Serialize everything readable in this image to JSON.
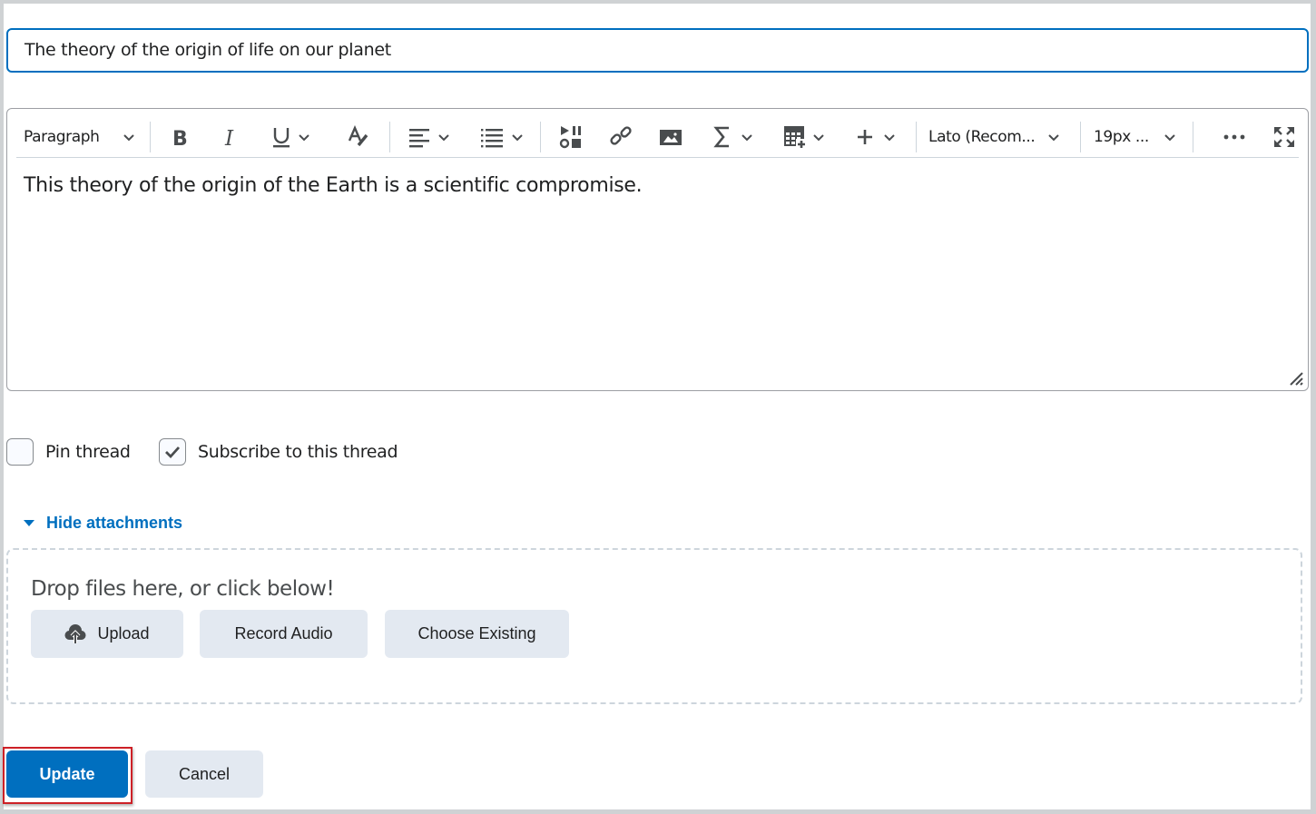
{
  "title_field": {
    "value": "The theory of the origin of life on our planet"
  },
  "editor": {
    "toolbar": {
      "block_format": "Paragraph",
      "font_family": "Lato (Recom...",
      "font_size": "19px ..."
    },
    "content": "This theory of the origin of the Earth is a scientific compromise."
  },
  "options": {
    "pin_thread": {
      "label": "Pin thread",
      "checked": false
    },
    "subscribe": {
      "label": "Subscribe to this thread",
      "checked": true
    }
  },
  "attachments": {
    "toggle_label": "Hide attachments",
    "drop_text": "Drop files here, or click below!",
    "buttons": {
      "upload": "Upload",
      "record_audio": "Record Audio",
      "choose_existing": "Choose Existing"
    }
  },
  "actions": {
    "update": "Update",
    "cancel": "Cancel"
  },
  "colors": {
    "accent": "#006fbf",
    "highlight": "#cd2026",
    "button_secondary": "#e3e9f1"
  }
}
